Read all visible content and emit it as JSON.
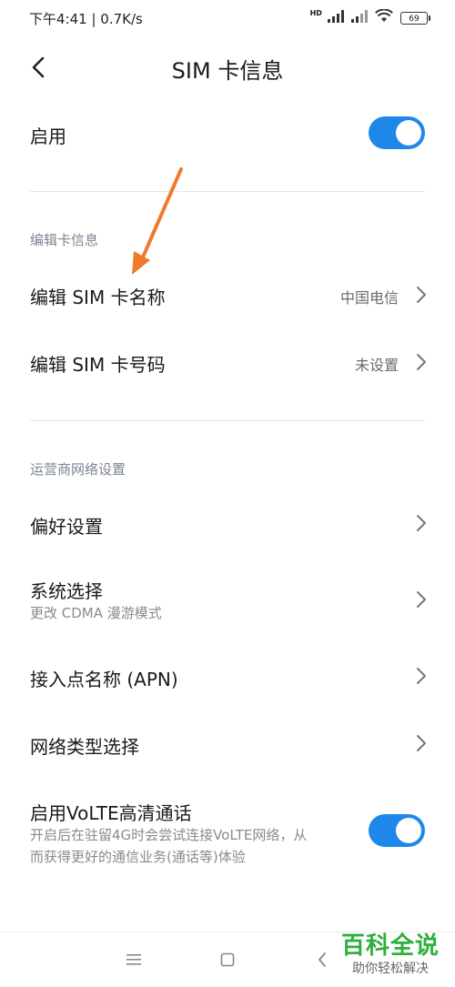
{
  "status_bar": {
    "time_speed": "下午4:41 | 0.7K/s",
    "hd_label": "HD",
    "battery": "69"
  },
  "header": {
    "title": "SIM 卡信息"
  },
  "enable": {
    "label": "启用",
    "on": true
  },
  "edit_section": {
    "title": "编辑卡信息",
    "items": [
      {
        "label": "编辑 SIM 卡名称",
        "value": "中国电信"
      },
      {
        "label": "编辑 SIM 卡号码",
        "value": "未设置"
      }
    ]
  },
  "carrier_section": {
    "title": "运营商网络设置",
    "items": [
      {
        "label": "偏好设置"
      },
      {
        "label": "系统选择",
        "sub": "更改 CDMA 漫游模式"
      },
      {
        "label": "接入点名称 (APN)"
      },
      {
        "label": "网络类型选择"
      }
    ]
  },
  "volte": {
    "label": "启用VoLTE高清通话",
    "sub_line1": "开启后在驻留4G时会尝试连接VoLTE网络，从",
    "sub_line2": "而获得更好的通信业务(通话等)体验",
    "on": true
  },
  "watermark": {
    "brand": "百科全说",
    "slogan": "助你轻松解决"
  },
  "colors": {
    "accent": "#1e88ea",
    "annotation_arrow": "#f07a2c",
    "watermark_green": "#2faf3b"
  }
}
